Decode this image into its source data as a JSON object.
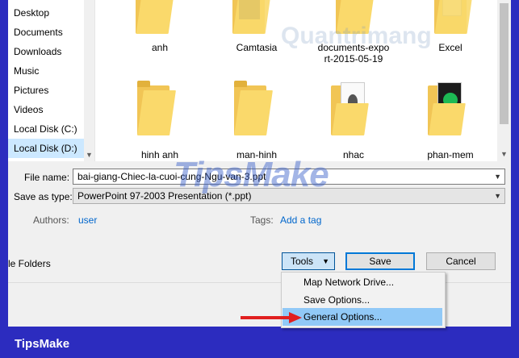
{
  "sidebar": {
    "items": [
      {
        "label": "Desktop"
      },
      {
        "label": "Documents"
      },
      {
        "label": "Downloads"
      },
      {
        "label": "Music"
      },
      {
        "label": "Pictures"
      },
      {
        "label": "Videos"
      },
      {
        "label": "Local Disk (C:)"
      },
      {
        "label": "Local Disk (D:)",
        "selected": true
      }
    ]
  },
  "files": [
    {
      "name": "anh"
    },
    {
      "name": "Camtasia"
    },
    {
      "name": "documents-expo rt-2015-05-19"
    },
    {
      "name": "Excel"
    },
    {
      "name": "hinh anh"
    },
    {
      "name": "man-hinh"
    },
    {
      "name": "nhac"
    },
    {
      "name": "phan-mem"
    }
  ],
  "form": {
    "file_name_label": "File name:",
    "file_name_value": "bai-giang-Chiec-la-cuoi-cung-Ngu-van-3.ppt",
    "save_type_label": "Save as type:",
    "save_type_value": "PowerPoint 97-2003 Presentation (*.ppt)",
    "authors_label": "Authors:",
    "authors_value": "user",
    "tags_label": "Tags:",
    "tags_value": "Add a tag"
  },
  "footer": {
    "hide_folders": "le Folders",
    "tools_label": "Tools",
    "save_label": "Save",
    "cancel_label": "Cancel"
  },
  "tools_menu": {
    "items": [
      {
        "label": "Map Network Drive..."
      },
      {
        "label": "Save Options..."
      },
      {
        "label": "General Options...",
        "highlighted": true
      }
    ]
  },
  "watermark": {
    "brand": "TipsMake",
    "overlay": "TipsMake",
    "faint": "Quantrimang"
  },
  "colors": {
    "accent": "#0078d7",
    "selection": "#cce8ff",
    "highlight": "#91c9f7",
    "arrow": "#e11f1f",
    "frame_bg": "#2c2cbf"
  }
}
